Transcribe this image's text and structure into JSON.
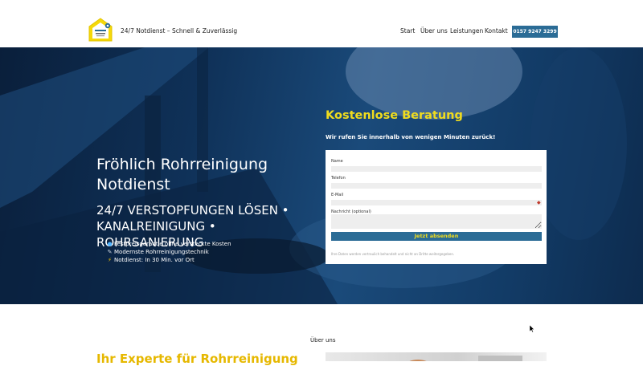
{
  "header": {
    "logo_icon": "company-logo-gear-icon",
    "tagline": "24/7 Notdienst – Schnell & Zuverlässig",
    "nav": [
      "Start",
      "Über uns",
      "Leistungen",
      "Kontakt"
    ],
    "phone_button": "0157 9247 3299"
  },
  "hero": {
    "title": "Fröhlich Rohrreinigung Notdienst",
    "subtitle": "24/7 VERSTOPFUNGEN LÖSEN • KANALREINIGUNG • ROHRSANIERUNG",
    "features": [
      {
        "icon": "droplet-icon",
        "text": "Festpreisgarantie ohne versteckte Kosten"
      },
      {
        "icon": "wrench-icon",
        "text": "Modernste Rohrreinigungstechnik"
      },
      {
        "icon": "lightning-icon",
        "text": "Notdienst: In 30 Min. vor Ort"
      }
    ]
  },
  "form": {
    "title": "Kostenlose Beratung",
    "subtitle": "Wir rufen Sie innerhalb von wenigen Minuten zurück!",
    "fields": {
      "name": "Name",
      "phone": "Telefon",
      "email": "E-Mail",
      "message": "Nachricht (optional)"
    },
    "submit": "Jetzt absenden",
    "note": "Ihre Daten werden vertraulich behandelt und nicht an Dritte weitergegeben."
  },
  "about": {
    "label": "Über uns",
    "heading": "Ihr Experte für Rohrreinigung"
  },
  "colors": {
    "accent_blue": "#2b6c96",
    "accent_yellow": "#f0dc1e",
    "hero_dark": "#0f3158"
  }
}
